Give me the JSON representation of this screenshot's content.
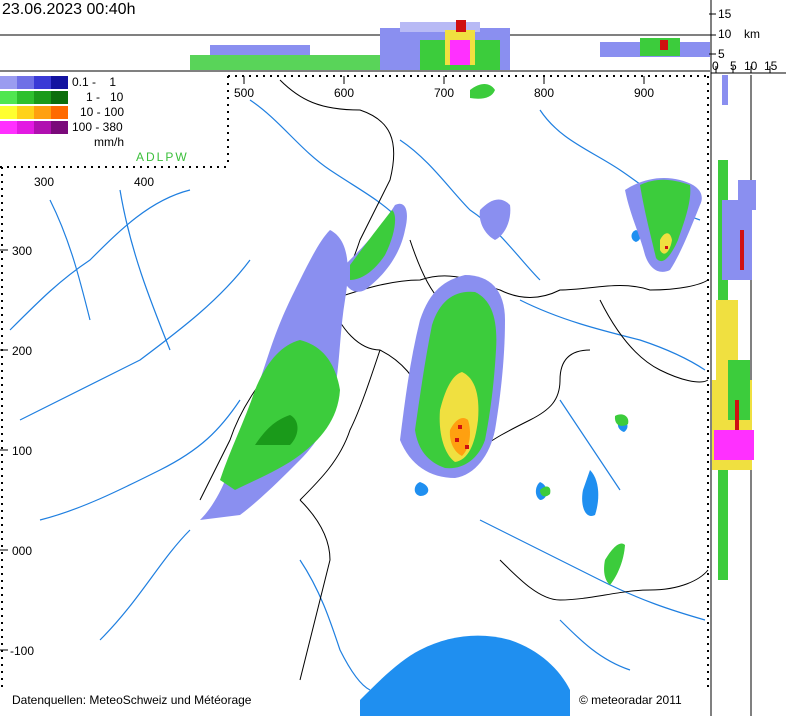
{
  "timestamp": "23.06.2023 00:40h",
  "legend": {
    "rows": [
      {
        "range": "0.1 -    1",
        "colors": [
          "#9a9cf0",
          "#6f70e6",
          "#3a3ad6",
          "#1212a0"
        ]
      },
      {
        "range": "1 -   10",
        "colors": [
          "#50e650",
          "#2ec02e",
          "#1a9a1a",
          "#0c6e0c"
        ]
      },
      {
        "range": "10 - 100",
        "colors": [
          "#ffff30",
          "#ffd21a",
          "#ffa010",
          "#ff6a00"
        ]
      },
      {
        "range": "100 - 380",
        "colors": [
          "#ff30ff",
          "#e21ae2",
          "#b010b0",
          "#7a0a7a"
        ]
      }
    ],
    "unit": "mm/h"
  },
  "network_label": "ADLPW",
  "x_axis_ticks": [
    "500",
    "600",
    "700",
    "800",
    "900"
  ],
  "x_axis_ticks_lower": [
    "300",
    "400"
  ],
  "y_axis_ticks": [
    "300",
    "200",
    "100",
    "000",
    "-100"
  ],
  "height_axis": {
    "ticks": [
      "15",
      "10",
      "5",
      "0"
    ],
    "unit": "km"
  },
  "side_axis_ticks": [
    "5",
    "10",
    "15"
  ],
  "colors": {
    "river": "#1f7fe0",
    "lake": "#1f8ff0",
    "border": "#000000",
    "green": "#3ccc3c",
    "blue_light": "#8a8ff0",
    "yellow": "#f0e040",
    "red": "#d01010",
    "magenta": "#ff30ff"
  },
  "credits_left": "Datenquellen: MeteoSchweiz und Météorage",
  "credits_right": "© meteoradar 2011"
}
